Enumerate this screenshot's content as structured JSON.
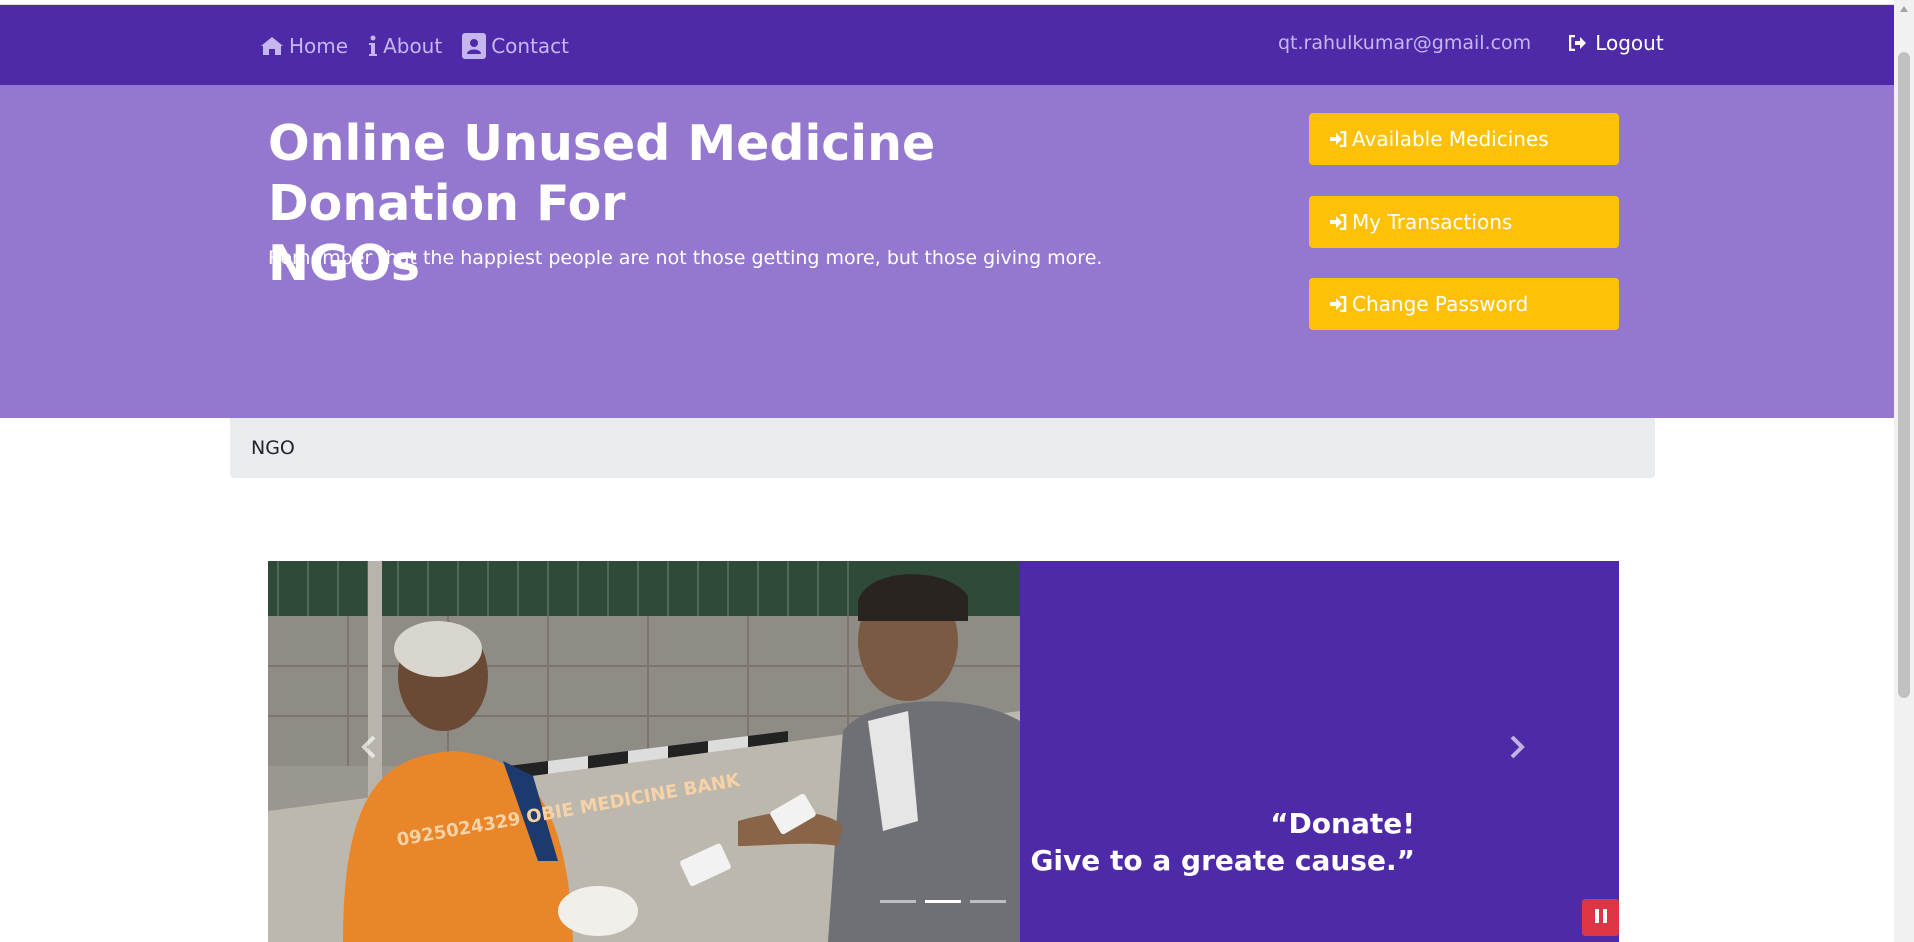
{
  "navbar": {
    "links": [
      {
        "label": "Home",
        "icon": "home-icon"
      },
      {
        "label": "About",
        "icon": "info-icon"
      },
      {
        "label": "Contact",
        "icon": "contact-card-icon"
      }
    ],
    "user_email": "qt.rahulkumar@gmail.com",
    "logout_label": "Logout"
  },
  "hero": {
    "title_line1": "Online Unused Medicine Donation For",
    "title_line2": "NGOs",
    "subtitle": "Remember that the happiest people are not those getting more, but those giving more.",
    "buttons": [
      {
        "label": "Available Medicines",
        "icon": "sign-in-icon"
      },
      {
        "label": "My Transactions",
        "icon": "sign-in-icon"
      },
      {
        "label": "Change Password",
        "icon": "sign-in-icon"
      }
    ]
  },
  "breadcrumb": {
    "label": "NGO"
  },
  "carousel": {
    "caption_line1": "“Donate!",
    "caption_line2": "Give to a greate cause.”",
    "indicator_count": 3,
    "active_indicator": 2,
    "photo_text": "0925024329 OBIE MEDICINE BANK"
  },
  "colors": {
    "navbar": "#4f2aa8",
    "hero": "#9478d0",
    "button": "#ffc107",
    "pause": "#dc3545",
    "breadcrumb": "#e9ecef"
  }
}
